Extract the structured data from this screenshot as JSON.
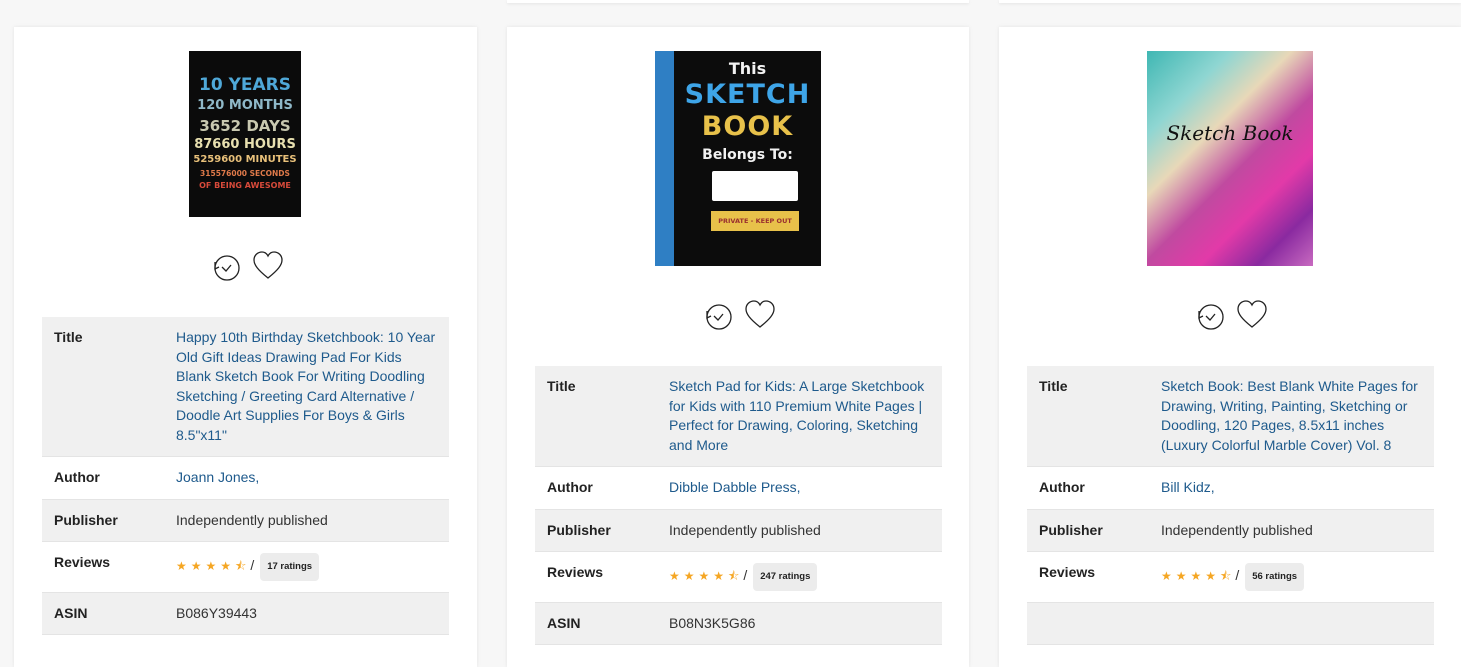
{
  "cards": [
    {
      "cover": {
        "lines": [
          "10 YEARS",
          "120 MONTHS",
          "3652 DAYS",
          "87660 HOURS",
          "5259600 MINUTES",
          "315576000 SECONDS",
          "OF BEING AWESOME"
        ]
      },
      "rows": {
        "title_label": "Title",
        "title_value": "Happy 10th Birthday Sketchbook: 10 Year Old Gift Ideas Drawing Pad For Kids Blank Sketch Book For Writing Doodling Sketching / Greeting Card Alternative / Doodle Art Supplies For Boys & Girls 8.5\"x11\"",
        "author_label": "Author",
        "author_value": "Joann Jones,",
        "publisher_label": "Publisher",
        "publisher_value": "Independently published",
        "reviews_label": "Reviews",
        "stars": "★★★★⯪",
        "sep": "/",
        "ratings": "17 ratings",
        "asin_label": "ASIN",
        "asin_value": "B086Y39443"
      }
    },
    {
      "cover": {
        "line1": "This",
        "line2": "SKETCH",
        "line3": "BOOK",
        "line4": "Belongs To:",
        "tag": "PRIVATE - KEEP OUT"
      },
      "rows": {
        "title_label": "Title",
        "title_value": "Sketch Pad for Kids: A Large Sketchbook for Kids with 110 Premium White Pages | Perfect for Drawing, Coloring, Sketching and More",
        "author_label": "Author",
        "author_value": "Dibble Dabble Press,",
        "publisher_label": "Publisher",
        "publisher_value": "Independently published",
        "reviews_label": "Reviews",
        "stars": "★★★★⯪",
        "sep": "/",
        "ratings": "247 ratings",
        "asin_label": "ASIN",
        "asin_value": "B08N3K5G86"
      }
    },
    {
      "cover": {
        "script": "Sketch Book"
      },
      "rows": {
        "title_label": "Title",
        "title_value": "Sketch Book: Best Blank White Pages for Drawing, Writing, Painting, Sketching or Doodling, 120 Pages, 8.5x11 inches (Luxury Colorful Marble Cover) Vol. 8",
        "author_label": "Author",
        "author_value": "Bill Kidz,",
        "publisher_label": "Publisher",
        "publisher_value": "Independently published",
        "reviews_label": "Reviews",
        "stars": "★★★★⯪",
        "sep": "/",
        "ratings": "56 ratings"
      }
    }
  ],
  "icons": {
    "history": "history-icon",
    "wishlist": "heart-icon"
  },
  "colors": {
    "link": "#1e5a8c",
    "star": "#f5a623",
    "row_alt": "#f0f0f0"
  }
}
